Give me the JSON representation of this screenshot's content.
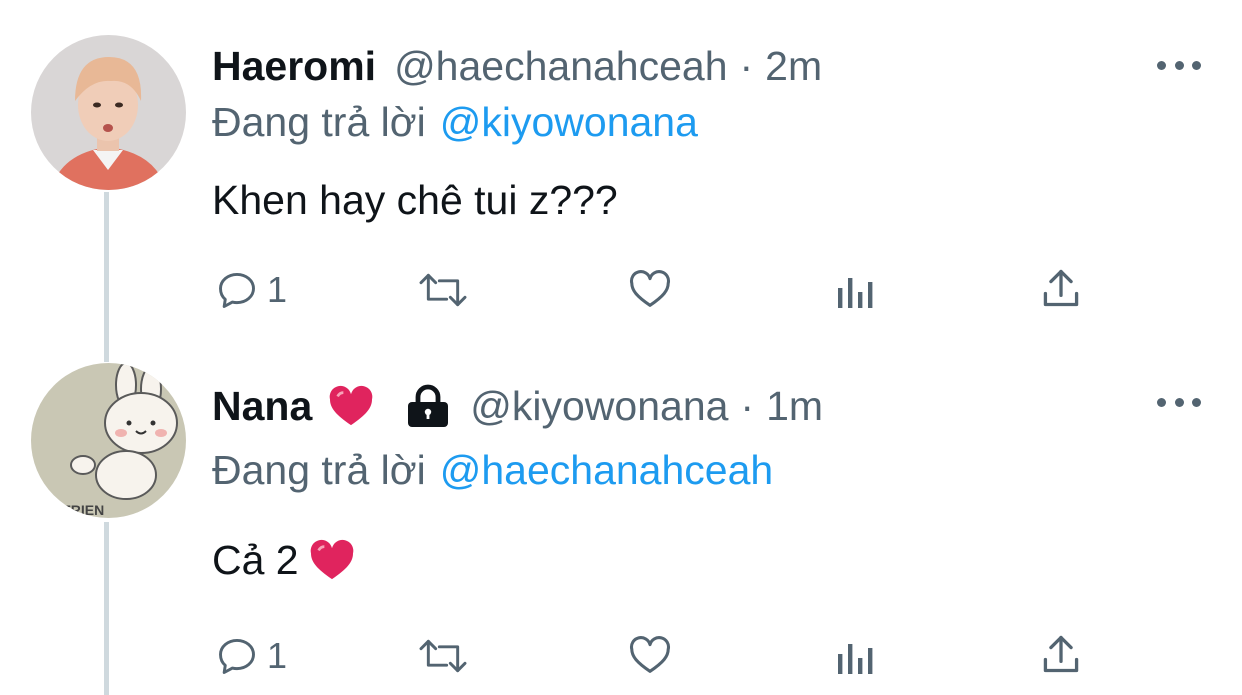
{
  "tweets": [
    {
      "name": "Haeromi",
      "handle": "@haechanahceah",
      "separator": "·",
      "time": "2m",
      "replying_prefix": "Đang trả lời",
      "replying_to": "@kiyowonana",
      "text": "Khen hay chê tui z???",
      "reply_count": "1"
    },
    {
      "name": "Nana",
      "name_emoji": "red-heart-emoji",
      "protected_icon": "lock-icon",
      "handle": "@kiyowonana",
      "separator": "·",
      "time": "1m",
      "replying_prefix": "Đang trả lời",
      "replying_to": "@haechanahceah",
      "text": "Cả 2",
      "text_emoji": "red-heart-emoji",
      "reply_count": "1"
    }
  ],
  "actions": [
    "reply-icon",
    "retweet-icon",
    "like-icon",
    "analytics-icon",
    "share-icon"
  ],
  "colors": {
    "accent": "#1d9bf0",
    "secondary_text": "#536471",
    "thread_line": "#cfd9de",
    "heart": "#e0245e"
  }
}
